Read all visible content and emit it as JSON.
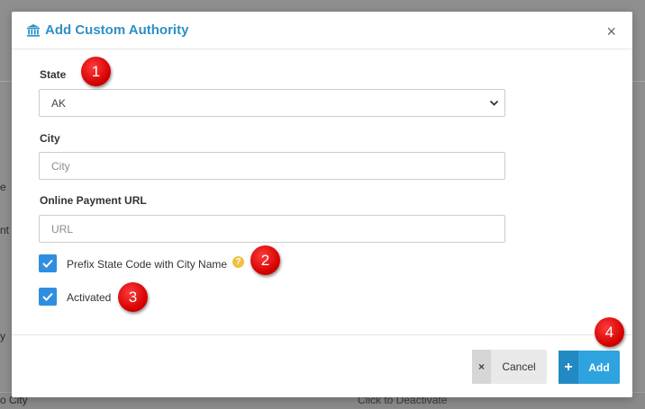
{
  "background": {
    "snippet_1": "e",
    "snippet_2": "nt /",
    "snippet_3": "y",
    "snippet_4": "o City",
    "snippet_5": "Click to Deactivate"
  },
  "modal": {
    "title": "Add Custom Authority",
    "title_icon": "bank-icon",
    "close_label": "×"
  },
  "form": {
    "state": {
      "label": "State",
      "value": "AK"
    },
    "city": {
      "label": "City",
      "placeholder": "City",
      "value": ""
    },
    "payment_url": {
      "label": "Online Payment URL",
      "placeholder": "URL",
      "value": ""
    },
    "prefix_checkbox": {
      "label": "Prefix State Code with City Name",
      "checked": true
    },
    "activated_checkbox": {
      "label": "Activated",
      "checked": true
    }
  },
  "footer": {
    "cancel_label": "Cancel",
    "cancel_icon": "×",
    "add_label": "Add",
    "add_icon": "+"
  },
  "markers": [
    "1",
    "2",
    "3",
    "4"
  ],
  "colors": {
    "accent": "#2e8fc6",
    "checkbox": "#2f8ee0",
    "add_button": "#2fa3df",
    "marker": "#d40000",
    "help_icon": "#f0c040"
  }
}
